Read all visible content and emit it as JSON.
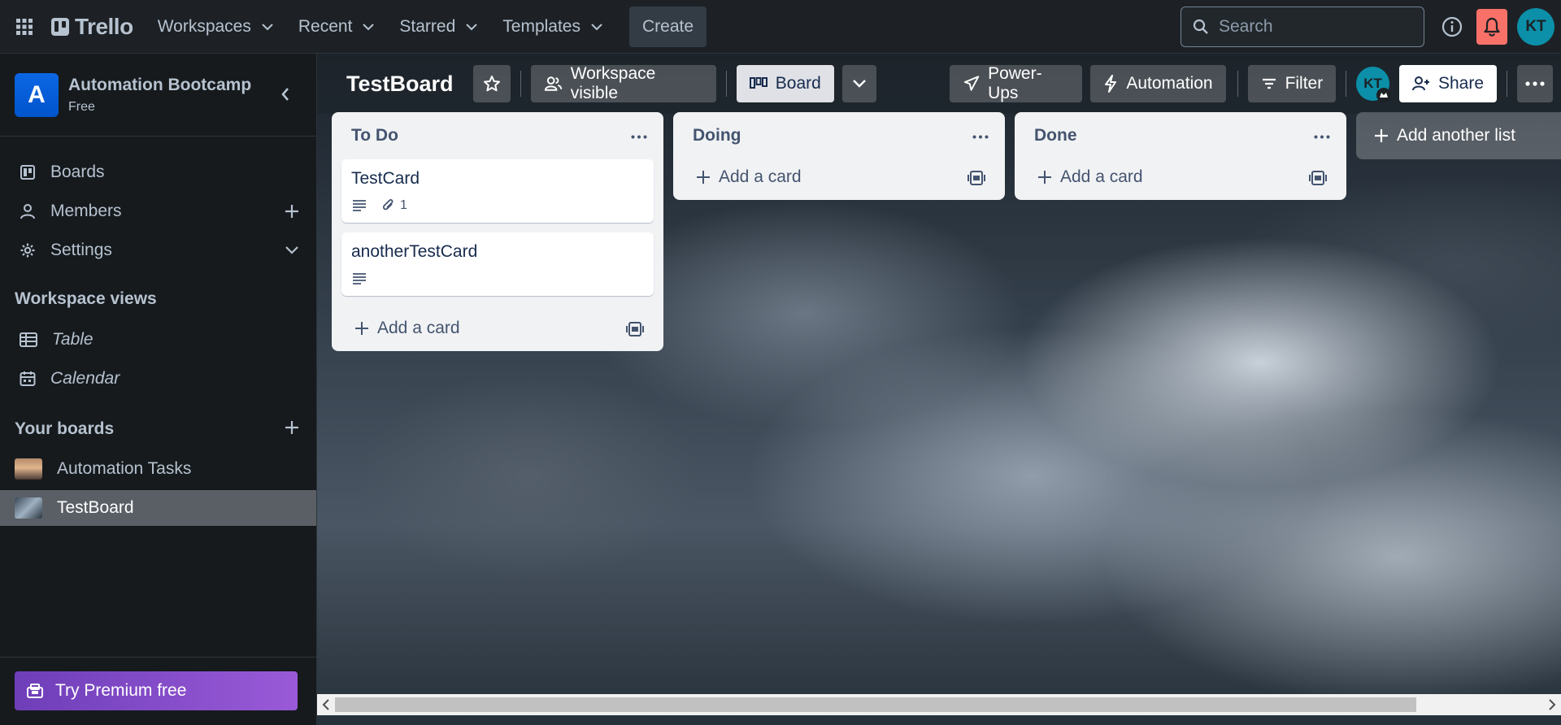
{
  "topbar": {
    "logo_text": "Trello",
    "nav": [
      "Workspaces",
      "Recent",
      "Starred",
      "Templates"
    ],
    "create_label": "Create",
    "search_placeholder": "Search",
    "avatar_initials": "KT",
    "icons": [
      "apps-grid-icon",
      "chevron-down-icon",
      "search-icon",
      "info-icon",
      "bell-icon"
    ]
  },
  "sidebar": {
    "workspace_initial": "A",
    "workspace_name": "Automation Bootcamp",
    "workspace_plan": "Free",
    "items": [
      {
        "label": "Boards"
      },
      {
        "label": "Members"
      },
      {
        "label": "Settings"
      }
    ],
    "views_title": "Workspace views",
    "views": [
      {
        "label": "Table"
      },
      {
        "label": "Calendar"
      }
    ],
    "your_boards_title": "Your boards",
    "boards": [
      {
        "label": "Automation Tasks",
        "active": false
      },
      {
        "label": "TestBoard",
        "active": true
      }
    ],
    "premium_label": "Try Premium free"
  },
  "board": {
    "title": "TestBoard",
    "visibility_label": "Workspace visible",
    "view_label": "Board",
    "powerups_label": "Power-Ups",
    "automation_label": "Automation",
    "filter_label": "Filter",
    "member_initials": "KT",
    "share_label": "Share",
    "add_list_label": "Add another list",
    "add_card_label": "Add a card",
    "lists": [
      {
        "title": "To Do",
        "cards": [
          {
            "title": "TestCard",
            "has_description": true,
            "attachments": "1"
          },
          {
            "title": "anotherTestCard",
            "has_description": true
          }
        ]
      },
      {
        "title": "Doing",
        "cards": []
      },
      {
        "title": "Done",
        "cards": []
      }
    ]
  },
  "colors": {
    "topbar_bg": "#1d2125",
    "sidebar_bg": "#161a1d",
    "notification_bg": "#f87168",
    "avatar_bg": "#0c8fa8",
    "list_bg": "#f1f2f4",
    "premium_gradient": [
      "#6e3eb8",
      "#9a5ad8"
    ]
  }
}
